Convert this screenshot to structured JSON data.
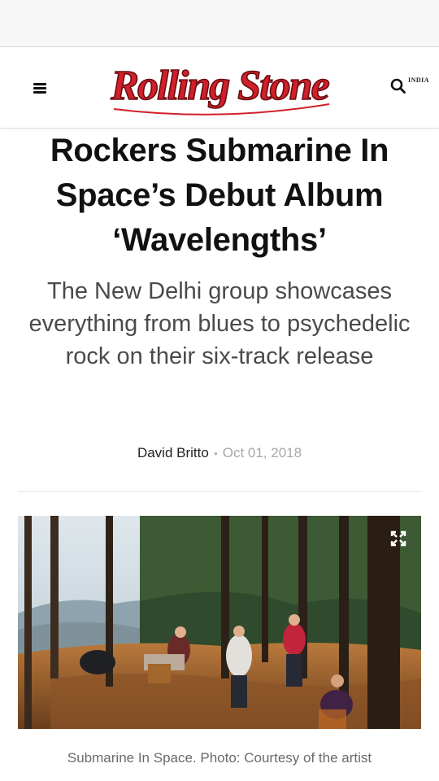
{
  "header": {
    "logo_text": "Rolling Stone",
    "edition": "INDIA"
  },
  "article": {
    "title": "Rockers Submarine In Space’s Debut Album ‘Wavelengths’",
    "subtitle": "The New Delhi group showcases everything from blues to psychedelic rock on their six-track release",
    "author": "David Britto",
    "separator": "•",
    "date": "Oct 01, 2018",
    "image_caption": "Submarine In Space. Photo: Courtesy of the artist"
  },
  "colors": {
    "logo_red": "#d0202a",
    "text_dark": "#111111",
    "subtitle_gray": "#4a4a4a",
    "date_gray": "#a8a8a8"
  },
  "icons": {
    "menu": "hamburger-menu-icon",
    "search": "search-icon",
    "expand": "expand-icon"
  }
}
